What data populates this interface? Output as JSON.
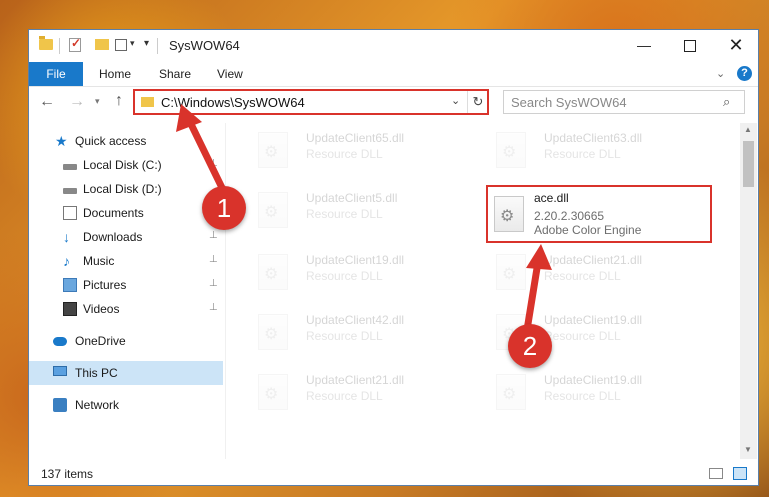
{
  "window": {
    "title": "SysWOW64",
    "minimize": "—",
    "maximize": "",
    "close": "✕"
  },
  "quick_access_toolbar": {
    "dropdown": "▾",
    "props_dropdown": "▾"
  },
  "ribbon": {
    "tabs": [
      "File",
      "Home",
      "Share",
      "View"
    ],
    "chevron": "⌄",
    "help": "?"
  },
  "address": {
    "back": "←",
    "forward": "→",
    "recent": "▾",
    "up": "↑",
    "path": "C:\\Windows\\SysWOW64",
    "dropdown": "⌄",
    "refresh": "↻",
    "search_placeholder": "Search SysWOW64",
    "search_icon": "⌕"
  },
  "sidebar": {
    "items": [
      {
        "label": "Quick access",
        "icon": "star-icon",
        "pinned": false
      },
      {
        "label": "Local Disk (C:)",
        "icon": "drive-icon",
        "pinned": true
      },
      {
        "label": "Local Disk (D:)",
        "icon": "drive-icon",
        "pinned": false
      },
      {
        "label": "Documents",
        "icon": "documents-icon",
        "pinned": true
      },
      {
        "label": "Downloads",
        "icon": "downloads-icon",
        "pinned": true
      },
      {
        "label": "Music",
        "icon": "music-icon",
        "pinned": true
      },
      {
        "label": "Pictures",
        "icon": "pictures-icon",
        "pinned": true
      },
      {
        "label": "Videos",
        "icon": "videos-icon",
        "pinned": true
      },
      {
        "label": "OneDrive",
        "icon": "onedrive-icon",
        "pinned": false
      },
      {
        "label": "This PC",
        "icon": "pc-icon",
        "pinned": false,
        "selected": true
      },
      {
        "label": "Network",
        "icon": "network-icon",
        "pinned": false
      }
    ],
    "pin_glyph": "📌"
  },
  "files": [
    {
      "name": "UpdateClient65.dll",
      "desc": "Resource DLL"
    },
    {
      "name": "UpdateClient63.dll",
      "desc": "Resource DLL"
    },
    {
      "name": "UpdateClient5.dll",
      "desc": "Resource DLL"
    },
    {
      "name": "ace.dll",
      "version": "2.20.2.30665",
      "desc": "Adobe Color Engine",
      "highlighted": true
    },
    {
      "name": "UpdateClient19.dll",
      "desc": "Resource DLL"
    },
    {
      "name": "UpdateClient21.dll",
      "desc": "Resource DLL"
    },
    {
      "name": "UpdateClient42.dll",
      "desc": "Resource DLL"
    },
    {
      "name": "UpdateClient19.dll",
      "desc": "Resource DLL"
    },
    {
      "name": "UpdateClient21.dll",
      "desc": "Resource DLL"
    },
    {
      "name": "UpdateClient19.dll",
      "desc": "Resource DLL"
    }
  ],
  "scrollbar": {
    "up": "▲",
    "down": "▼"
  },
  "status": {
    "item_count": "137 items"
  },
  "annotations": {
    "step1": "1",
    "step2": "2",
    "color": "#d9332b"
  }
}
